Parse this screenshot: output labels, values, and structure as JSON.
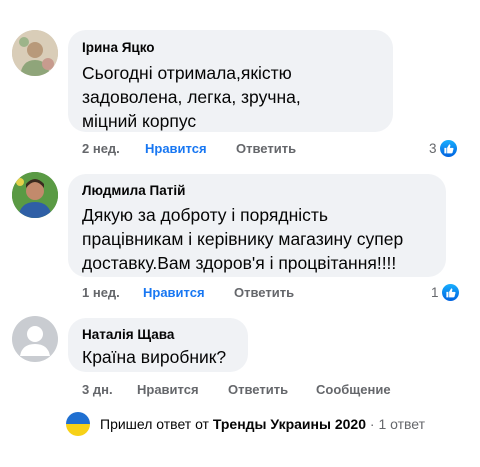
{
  "comments": [
    {
      "author": "Ірина Яцко",
      "lines": [
        "Сьогодні отримала,якістю",
        "задоволена, легка, зручна,",
        "міцний корпус"
      ],
      "time": "2 нед.",
      "like_label": "Нравится",
      "reply_label": "Ответить",
      "reaction_count": "3"
    },
    {
      "author": "Людмила Патій",
      "lines": [
        "Дякую за доброту і порядність",
        "працівникам і керівнику магазину супер",
        "доставку.Вам здоров'я  і процвітання!!!!"
      ],
      "time": "1 нед.",
      "like_label": "Нравится",
      "reply_label": "Ответить",
      "reaction_count": "1"
    },
    {
      "author": "Наталія Щава",
      "lines": [
        "Країна виробник?"
      ],
      "time": "3 дн.",
      "like_label": "Нравится",
      "reply_label": "Ответить",
      "message_label": "Сообщение"
    }
  ],
  "reply_summary": {
    "prefix": "Пришел ответ от",
    "author": "Тренды Украины 2020",
    "separator": "·",
    "count": "1 ответ"
  },
  "colors": {
    "bubble": "#f0f2f5",
    "accent": "#1877f2",
    "muted": "#65676b"
  },
  "icons": {
    "reaction": "like-icon",
    "reply_avatar": "ukraine-flag-icon",
    "default_avatar": "default-avatar-icon"
  }
}
